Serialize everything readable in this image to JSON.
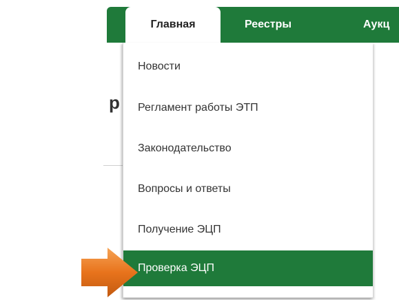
{
  "nav": {
    "tabs": [
      {
        "label": "Главная",
        "active": true
      },
      {
        "label": "Реестры",
        "active": false
      },
      {
        "label": "Аукц",
        "active": false
      }
    ]
  },
  "background": {
    "heading_fragment": "р"
  },
  "dropdown": {
    "items": [
      {
        "label": "Новости"
      },
      {
        "label": "Регламент работы ЭТП"
      },
      {
        "label": "Законодательство"
      },
      {
        "label": "Вопросы и ответы"
      },
      {
        "label": "Получение ЭЦП"
      },
      {
        "label": "Проверка ЭЦП",
        "highlighted": true
      }
    ]
  },
  "colors": {
    "nav_green": "#1f7a3a",
    "arrow_orange": "#e8731c"
  },
  "icons": {
    "pointer": "arrow-right-icon"
  }
}
